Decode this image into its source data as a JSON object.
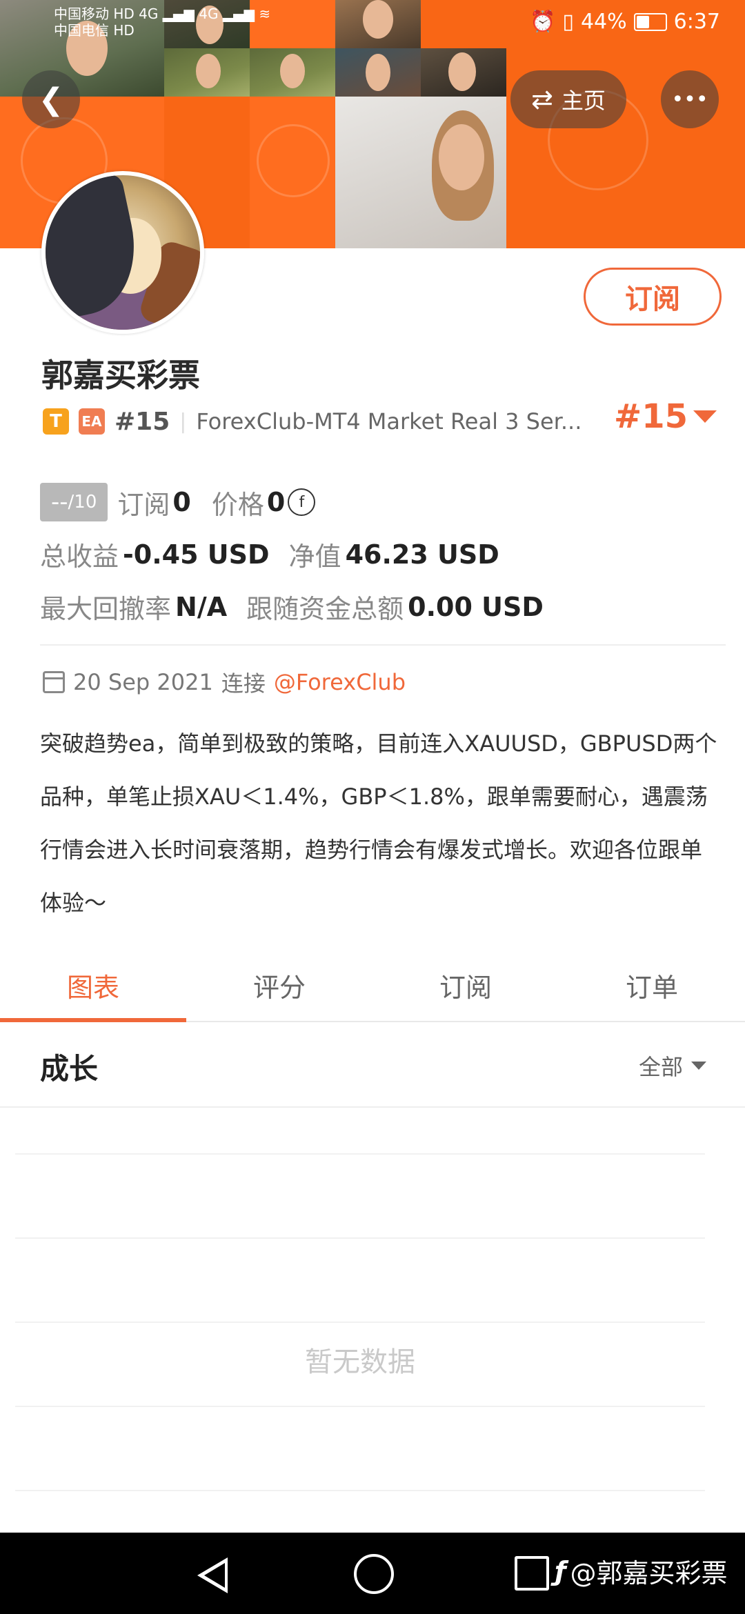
{
  "status_bar": {
    "carrier1": "中国移动",
    "carrier2": "中国电信",
    "hd": "HD",
    "net1": "4G",
    "net2": "4G",
    "battery": "44%",
    "time": "6:37"
  },
  "header": {
    "home_label": "主页",
    "more_label": "•••"
  },
  "profile": {
    "subscribe_label": "订阅",
    "name": "郭嘉买彩票",
    "badge_t": "T",
    "badge_ea": "EA",
    "rank": "#15",
    "separator": "|",
    "server": "ForexClub-MT4 Market Real 3 Ser...",
    "rank_big": "#15"
  },
  "stats": {
    "score": "--",
    "score_max": "/10",
    "subscribe_label": "订阅",
    "subscribe_count": "0",
    "price_label": "价格",
    "price_value": "0",
    "coin_symbol": "f",
    "profit_label": "总收益",
    "profit_value": "-0.45 USD",
    "equity_label": "净值",
    "equity_value": "46.23 USD",
    "drawdown_label": "最大回撤率",
    "drawdown_value": "N/A",
    "follow_label": "跟随资金总额",
    "follow_value": "0.00 USD"
  },
  "connection": {
    "date": "20 Sep 2021",
    "connect_label": "连接",
    "broker": "@ForexClub"
  },
  "description": "突破趋势ea，简单到极致的策略，目前连入XAUUSD，GBPUSD两个品种，单笔止损XAU＜1.4%，GBP＜1.8%，跟单需要耐心，遇震荡行情会进入长时间衰落期，趋势行情会有爆发式增长。欢迎各位跟单体验～",
  "tabs": [
    {
      "label": "图表",
      "active": true
    },
    {
      "label": "评分",
      "active": false
    },
    {
      "label": "订阅",
      "active": false
    },
    {
      "label": "订单",
      "active": false
    }
  ],
  "chart_section": {
    "title": "成长",
    "filter_label": "全部",
    "empty_text": "暂无数据"
  },
  "watermark": "@郭嘉买彩票",
  "colors": {
    "accent": "#f0683a",
    "banner_orange": "#ff6d1f"
  }
}
